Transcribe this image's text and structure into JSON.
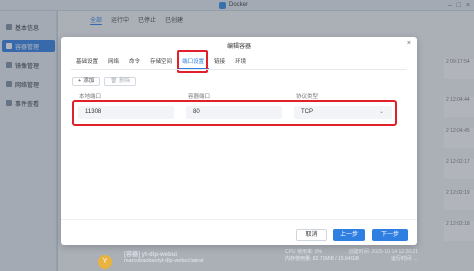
{
  "window": {
    "title": "Docker"
  },
  "sidebar": {
    "items": [
      {
        "label": "基本信息",
        "active": false,
        "icon": "info-icon"
      },
      {
        "label": "容器管理",
        "active": true,
        "icon": "container-icon"
      },
      {
        "label": "镜像管理",
        "active": false,
        "icon": "image-icon"
      },
      {
        "label": "网络管理",
        "active": false,
        "icon": "network-icon"
      },
      {
        "label": "事件查看",
        "active": false,
        "icon": "event-icon"
      }
    ]
  },
  "background": {
    "tabs": [
      "全部",
      "运行中",
      "已停止",
      "已创建"
    ],
    "row_times": [
      {
        "time": "2 09:17:54"
      },
      {
        "time": "2 12:04:44"
      },
      {
        "time": "2 12:04:45"
      },
      {
        "time": "2 12:02:17"
      },
      {
        "time": "2 12:02:19"
      },
      {
        "time": "2 12:02:18"
      }
    ],
    "bottom_card": {
      "avatar": "Y",
      "name": "[容器] yt-dlp-webui",
      "image": "marcobaobao/yt-dlp-webui:latest",
      "stats_line1": "CPU 使用率: 0%",
      "stats_line2": "内存使用量: 82.71MiB / 15.64GiB",
      "time_line1": "创建时间: 2025-10-14 12:20:21",
      "time_line2": "运行时间: ..."
    }
  },
  "modal": {
    "title": "编辑容器",
    "tabs": [
      {
        "label": "基础设置",
        "active": false
      },
      {
        "label": "网络",
        "active": false
      },
      {
        "label": "命令",
        "active": false
      },
      {
        "label": "存储空间",
        "active": false
      },
      {
        "label": "端口设置",
        "active": true
      },
      {
        "label": "链接",
        "active": false
      },
      {
        "label": "环境",
        "active": false
      }
    ],
    "add_label": "添加",
    "delete_label": "删除",
    "columns": {
      "local_port": "本地端口",
      "container_port": "容器端口",
      "protocol": "协议类型"
    },
    "port": {
      "local": "11308",
      "container": "80",
      "protocol": "TCP"
    },
    "cancel_label": "取消",
    "prev_label": "上一步",
    "next_label": "下一步"
  },
  "colors": {
    "accent": "#2f7fe3",
    "highlight": "#e0202a"
  }
}
